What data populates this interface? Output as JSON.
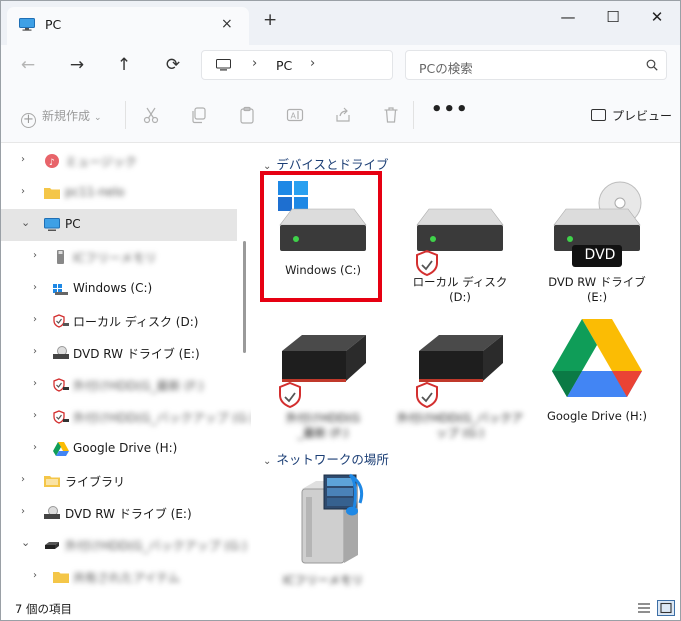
{
  "tab": {
    "title": "PC",
    "close": "×",
    "new_tab": "+"
  },
  "window_controls": {
    "minimize": "—",
    "maximize": "☐",
    "close": "✕"
  },
  "nav": {
    "back": "←",
    "forward": "→",
    "up": "↑",
    "refresh": "⟳"
  },
  "address": {
    "sep1": "›",
    "location": "PC",
    "sep2": "›"
  },
  "search": {
    "placeholder": "PCの検索"
  },
  "command_bar": {
    "new_label": "新規作成",
    "more": "•••",
    "preview_label": "プレビュー"
  },
  "sidebar": {
    "items": [
      {
        "label": "ミュージック",
        "blurred": true,
        "icon": "music-icon"
      },
      {
        "label": "pc11-nelo",
        "blurred": true,
        "icon": "folder-icon"
      },
      {
        "label": "PC",
        "blurred": false,
        "icon": "pc-icon",
        "selected": true,
        "expanded": true
      },
      {
        "label": "ICフリーメモリ",
        "blurred": true,
        "icon": "usb-icon"
      },
      {
        "label": "Windows (C:)",
        "blurred": false,
        "icon": "windows-drive-icon"
      },
      {
        "label": "ローカル ディスク (D:)",
        "blurred": false,
        "icon": "local-disk-icon"
      },
      {
        "label": "DVD RW ドライブ (E:)",
        "blurred": false,
        "icon": "dvd-drive-icon"
      },
      {
        "label": "外付けHDD(G_最新 (F:)",
        "blurred": true,
        "icon": "external-disk-icon"
      },
      {
        "label": "外付けHDD(G_バックアップ (G:)",
        "blurred": true,
        "icon": "external-disk-icon"
      },
      {
        "label": "Google Drive (H:)",
        "blurred": false,
        "icon": "google-drive-icon"
      },
      {
        "label": "ライブラリ",
        "blurred": false,
        "icon": "library-folder-icon"
      },
      {
        "label": "DVD RW ドライブ (E:)",
        "blurred": false,
        "icon": "dvd-drive-icon"
      },
      {
        "label": "外付けHDD(G_バックアップ (G:)",
        "blurred": true,
        "icon": "external-disk-icon"
      },
      {
        "label": "共有されたアイテム",
        "blurred": true,
        "icon": "folder-icon"
      }
    ]
  },
  "content": {
    "group_devices": "デバイスとドライブ",
    "group_network": "ネットワークの場所",
    "tiles": [
      {
        "label": "Windows (C:)",
        "blurred": false
      },
      {
        "label": "ローカル ディスク\n(D:)",
        "blurred": false
      },
      {
        "label": "DVD RW ドライブ\n(E:)",
        "blurred": false,
        "badge": "DVD"
      },
      {
        "label": "外付けHDD(G\n_最新 (F:)",
        "blurred": true
      },
      {
        "label": "外付けHDD(G_バックア\nップ (G:)",
        "blurred": true
      },
      {
        "label": "Google Drive (H:)",
        "blurred": false
      }
    ],
    "network_tiles": [
      {
        "label": "ICフリーメモリ",
        "blurred": true
      }
    ]
  },
  "status": {
    "count": "7 個の項目"
  },
  "colors": {
    "accent": "#005fb8",
    "highlight": "#e60012"
  }
}
